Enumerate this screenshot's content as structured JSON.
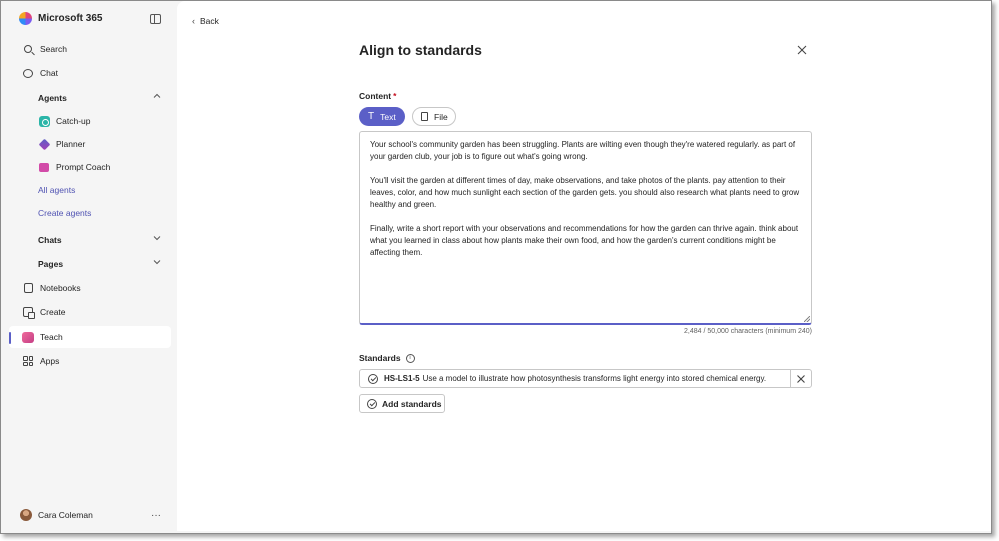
{
  "app": {
    "name": "Microsoft 365"
  },
  "sidebar": {
    "search": "Search",
    "chat": "Chat",
    "agents_section": "Agents",
    "agents": [
      {
        "label": "Catch-up",
        "icon": "catchup-icon"
      },
      {
        "label": "Planner",
        "icon": "planner-icon"
      },
      {
        "label": "Prompt Coach",
        "icon": "prompt-coach-icon"
      }
    ],
    "all_agents": "All agents",
    "create_agents": "Create agents",
    "chats_section": "Chats",
    "pages_section": "Pages",
    "notebooks": "Notebooks",
    "create": "Create",
    "teach": "Teach",
    "apps": "Apps",
    "user_name": "Cara Coleman",
    "more": "···"
  },
  "main": {
    "back_label": "Back",
    "title": "Align to standards",
    "content_label": "Content",
    "required_mark": "*",
    "tabs": [
      {
        "label": "Text",
        "active": true
      },
      {
        "label": "File",
        "active": false
      }
    ],
    "content_paragraphs": [
      "Your school's community garden has been struggling. Plants are wilting even though they're watered regularly. as part of your garden club, your job is to figure out what's going wrong.",
      "You'll visit the garden at different times of day, make observations, and take photos of the plants. pay attention to their leaves, color, and how much sunlight each section of the garden gets. you should also research what plants need to grow healthy and green.",
      "Finally, write a short report with your observations and recommendations for how the garden can thrive again. think about what you learned in class about how plants make their own food, and how the garden's current conditions might be affecting them."
    ],
    "char_count": "2,484 / 50,000 characters (minimum 240)",
    "standards_label": "Standards",
    "standards": [
      {
        "code": "HS-LS1-5",
        "description": "Use a model to illustrate how photosynthesis transforms light energy into stored chemical energy."
      }
    ],
    "add_standards_label": "Add standards"
  },
  "colors": {
    "accent": "#5b5fc7",
    "required": "#c50f1f",
    "sidebar_bg": "#f5f5f5"
  }
}
